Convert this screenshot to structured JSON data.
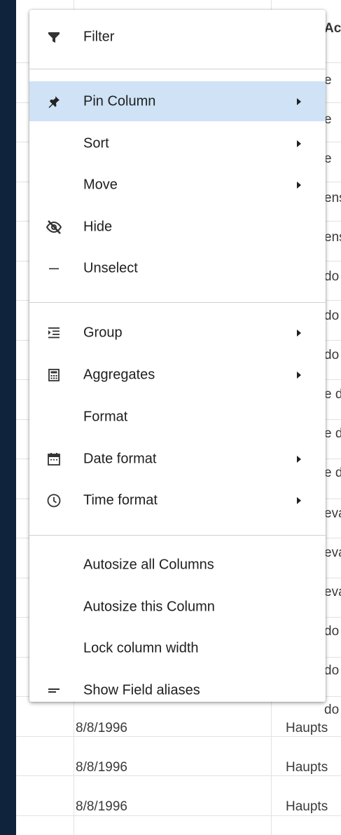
{
  "menu": {
    "items": [
      {
        "label": "Filter",
        "icon": "filter-icon",
        "submenu": false,
        "active": false
      },
      {
        "label": "Pin Column",
        "icon": "pin-icon",
        "submenu": true,
        "active": true
      },
      {
        "label": "Sort",
        "icon": "",
        "submenu": true,
        "active": false
      },
      {
        "label": "Move",
        "icon": "",
        "submenu": true,
        "active": false
      },
      {
        "label": "Hide",
        "icon": "eye-off-icon",
        "submenu": false,
        "active": false
      },
      {
        "label": "Unselect",
        "icon": "minus-icon",
        "submenu": false,
        "active": false
      },
      {
        "label": "Group",
        "icon": "group-indent-icon",
        "submenu": true,
        "active": false
      },
      {
        "label": "Aggregates",
        "icon": "calculator-icon",
        "submenu": true,
        "active": false
      },
      {
        "label": "Format",
        "icon": "",
        "submenu": false,
        "active": false
      },
      {
        "label": "Date format",
        "icon": "calendar-icon",
        "submenu": true,
        "active": false
      },
      {
        "label": "Time format",
        "icon": "clock-icon",
        "submenu": true,
        "active": false
      },
      {
        "label": "Autosize all Columns",
        "icon": "",
        "submenu": false,
        "active": false
      },
      {
        "label": "Autosize this Column",
        "icon": "",
        "submenu": false,
        "active": false
      },
      {
        "label": "Lock column width",
        "icon": "",
        "submenu": false,
        "active": false
      },
      {
        "label": "Show Field aliases",
        "icon": "text-lines-icon",
        "submenu": false,
        "active": false
      }
    ]
  },
  "grid": {
    "header_partial": "Ac",
    "partial_cells": [
      "e",
      "e",
      "e",
      "ens",
      "ens",
      "do",
      "do",
      "do",
      "e d",
      "e d",
      "e d",
      "eva",
      "eva",
      "eva",
      "do",
      "do",
      "do"
    ],
    "visible_rows": [
      {
        "date": "8/8/1996",
        "address": "Haupts"
      },
      {
        "date": "8/8/1996",
        "address": "Haupts"
      },
      {
        "date": "8/8/1996",
        "address": "Haupts"
      }
    ]
  },
  "colors": {
    "background": "#10233d",
    "menu_bg": "#ffffff",
    "active_bg": "#cfe2f6",
    "text": "#202020"
  }
}
